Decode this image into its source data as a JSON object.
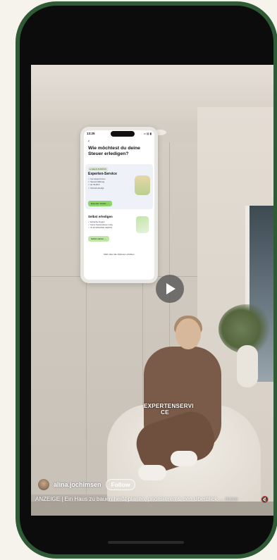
{
  "app_card": {
    "status_time": "13:25",
    "status_signal": "•• ▤ ▮",
    "back": "‹",
    "title": "Wie möchtest du deine Steuer erledigen?",
    "expert": {
      "badge": "● GELD ZURÜCK",
      "title": "Experten-Service",
      "lines": [
        "✓ Von Expert:innen",
        "✓ Steuererklärung",
        "✓ ab 39,99 €",
        "✓ Schnell erledigt"
      ],
      "button": "Experten starten →"
    },
    "self": {
      "title": "Selbst erledigen",
      "lines": [
        "✓ Einfache Fragen",
        "✓ Keine Steuerwissen nötig",
        "✓ IN 20 MINUTEN FERTIG"
      ],
      "button": "Selbst starten →"
    },
    "footer": "Mehr über die Optionen erfahren"
  },
  "video_caption": "EXPERTENSERVI CE",
  "user": {
    "username": "alina.jochimsen",
    "follow_label": "Follow"
  },
  "description": {
    "text": "ANZEIGE | Ein Haus zu bauen heißt planen, priorisieren & den Überblick",
    "more": "... more"
  },
  "icons": {
    "play": "play-icon",
    "mute": "mute-icon"
  }
}
